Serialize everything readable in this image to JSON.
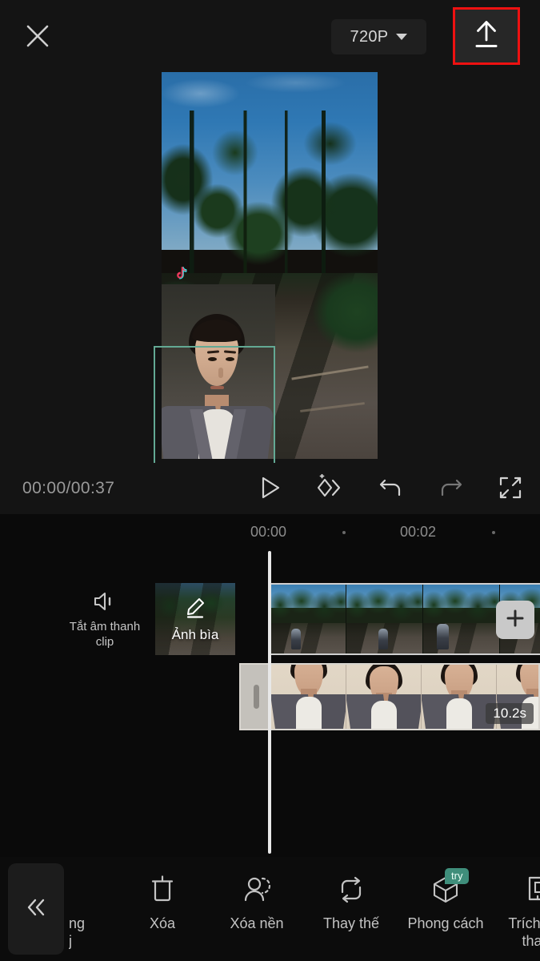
{
  "topbar": {
    "close_icon": "close-x-icon",
    "resolution": "720P",
    "resolution_caret_icon": "chevron-down-icon",
    "export_icon": "upload-export-icon",
    "export_highlight_color": "#ee1111"
  },
  "preview": {
    "watermark": "TikTok",
    "watermark_icon": "tiktok-note-icon",
    "selection_color": "#63a994"
  },
  "playback": {
    "time": "00:00/00:37",
    "controls": [
      {
        "name": "play-button",
        "icon": "play-triangle-icon"
      },
      {
        "name": "add-keyframe-button",
        "icon": "keyframe-diamond-plus-icon"
      },
      {
        "name": "undo-button",
        "icon": "undo-arrow-icon"
      },
      {
        "name": "redo-button",
        "icon": "redo-arrow-icon"
      },
      {
        "name": "fullscreen-button",
        "icon": "expand-fullscreen-icon"
      }
    ]
  },
  "timeline": {
    "ruler": {
      "labels": [
        "00:00",
        "00:02"
      ],
      "dot_marks": 2
    },
    "mute_clip": {
      "label": "Tắt âm thanh\nclip",
      "icon": "speaker-mute-icon"
    },
    "cover": {
      "label": "Ảnh bìa",
      "icon": "pencil-edit-icon"
    },
    "add_clip": {
      "icon": "plus-icon"
    },
    "overlay_clip": {
      "duration": "10.2s"
    }
  },
  "toolbar": {
    "collapse_icon": "double-chevron-left-icon",
    "items": [
      {
        "label": "ng\nj",
        "icon": "clipped-icon",
        "badge": "",
        "clipped": true
      },
      {
        "label": "Xóa",
        "icon": "trash-delete-icon",
        "badge": ""
      },
      {
        "label": "Xóa nền",
        "icon": "person-cutout-icon",
        "badge": ""
      },
      {
        "label": "Thay thế",
        "icon": "replace-loop-icon",
        "badge": ""
      },
      {
        "label": "Phong cách",
        "icon": "cube-style-icon",
        "badge": "try"
      },
      {
        "label": "Trích xuất\nthanh",
        "icon": "extract-audio-icon",
        "badge": ""
      }
    ],
    "badge_color": "#3f8e7b"
  }
}
